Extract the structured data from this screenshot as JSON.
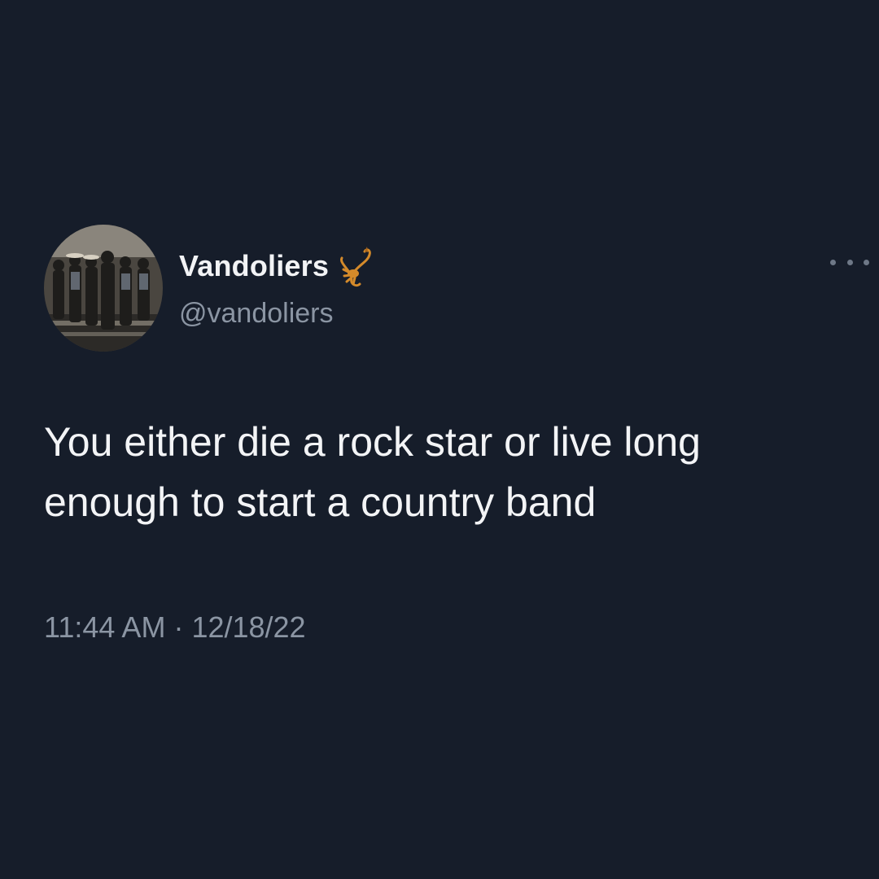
{
  "tweet": {
    "display_name": "Vandoliers",
    "handle": "@vandoliers",
    "text": "You either die a rock star or live long enough to start a country band",
    "time": "11:44 AM",
    "separator": "·",
    "date": "12/18/22",
    "name_emoji": "scorpion-icon"
  },
  "colors": {
    "background": "#161d2a",
    "primary_text": "#f3f4f6",
    "secondary_text": "#8b95a3",
    "scorpion": "#d48a2a"
  }
}
